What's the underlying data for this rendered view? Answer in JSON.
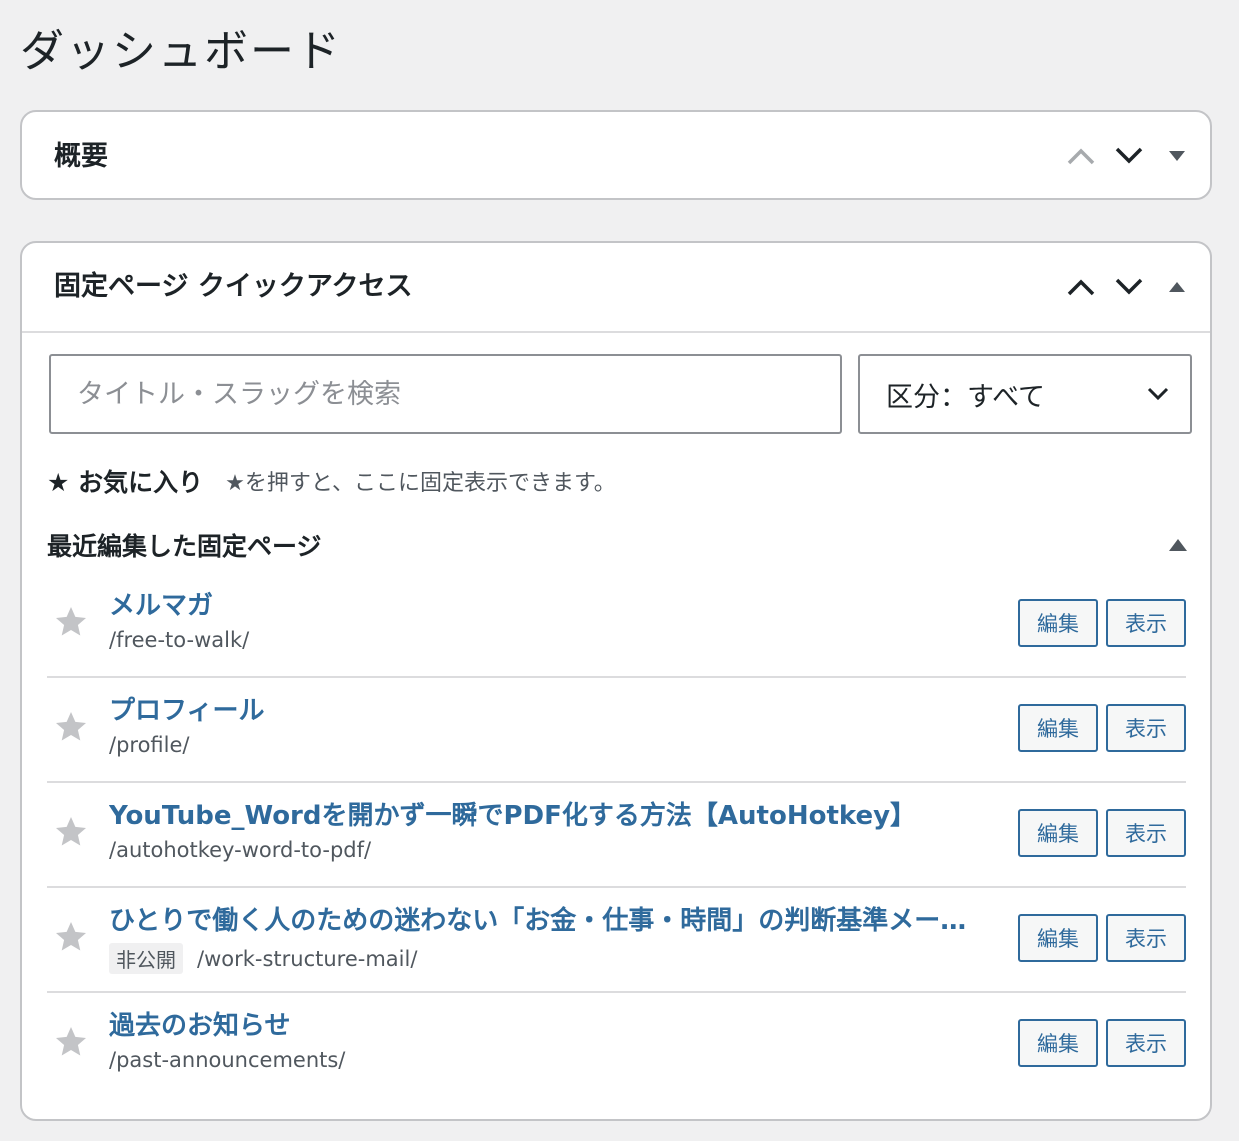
{
  "page": {
    "title": "ダッシュボード"
  },
  "overview": {
    "title": "概要"
  },
  "quick": {
    "title": "固定ページ クイックアクセス",
    "search_placeholder": "タイトル・スラッグを検索",
    "filter_label": "区分：すべて",
    "favorites_label": "★ お気に入り",
    "favorites_hint": "★を押すと、ここに固定表示できます。",
    "recent_title": "最近編集した固定ページ",
    "edit_label": "編集",
    "view_label": "表示",
    "pages": [
      {
        "title": "メルマガ",
        "slug": "/free-to-walk/",
        "status": ""
      },
      {
        "title": "プロフィール",
        "slug": "/profile/",
        "status": ""
      },
      {
        "title": "YouTube_Wordを開かず一瞬でPDF化する方法【AutoHotkey】",
        "slug": "/autohotkey-word-to-pdf/",
        "status": ""
      },
      {
        "title": "ひとりで働く人のための迷わない「お金・仕事・時間」の判断基準メール...",
        "slug": "/work-structure-mail/",
        "status": "非公開"
      },
      {
        "title": "過去のお知らせ",
        "slug": "/past-announcements/",
        "status": ""
      }
    ]
  },
  "colors": {
    "link": "#2f6a9c",
    "border": "#c3c4c7",
    "muted_icon": "#a7aaad",
    "text": "#1d2327"
  },
  "icons": {
    "move_up": "chevron-up-icon",
    "move_down": "chevron-down-icon",
    "toggle": "caret-icon",
    "star": "star-icon",
    "select": "chevron-down-icon"
  }
}
